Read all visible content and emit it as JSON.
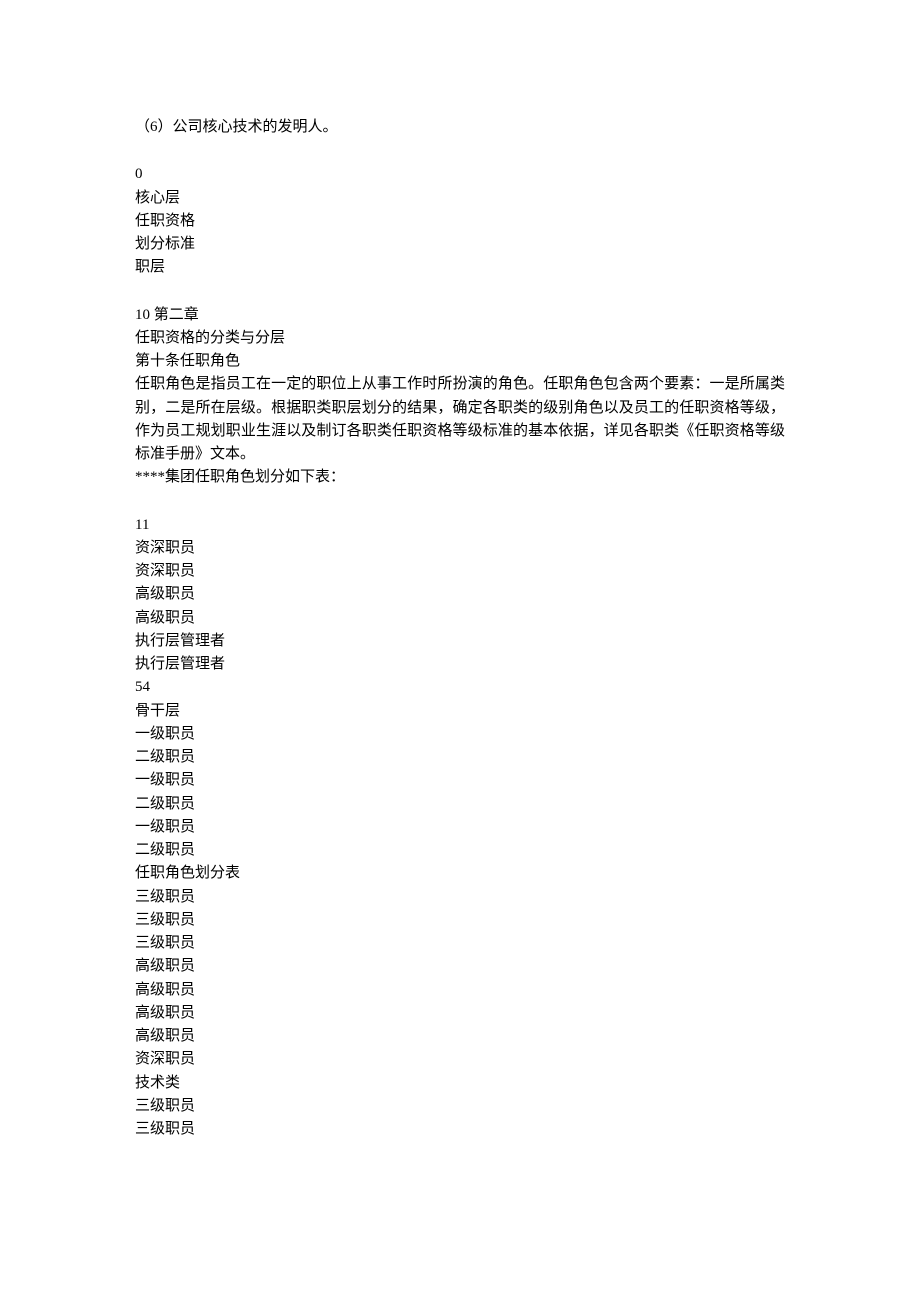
{
  "header_line": "（6）公司核心技术的发明人。",
  "section_a": {
    "lines": [
      "0",
      "核心层",
      "任职资格",
      "划分标准",
      "职层"
    ]
  },
  "section_b": {
    "heading": "10  第二章",
    "subtitle": "任职资格的分类与分层",
    "article_title": "第十条任职角色",
    "paragraph": "任职角色是指员工在一定的职位上从事工作时所扮演的角色。任职角色包含两个要素：一是所属类别，二是所在层级。根据职类职层划分的结果，确定各职类的级别角色以及员工的任职资格等级，作为员工规划职业生涯以及制订各职类任职资格等级标准的基本依据，详见各职类《任职资格等级标准手册》文本。",
    "closing": "****集团任职角色划分如下表："
  },
  "section_c": {
    "lines": [
      "11",
      "资深职员",
      "资深职员",
      "高级职员",
      "高级职员",
      "执行层管理者",
      "执行层管理者",
      "54",
      "骨干层",
      "一级职员",
      "二级职员",
      "一级职员",
      "二级职员",
      "一级职员",
      "二级职员",
      "任职角色划分表",
      "三级职员",
      "三级职员",
      "三级职员",
      "高级职员",
      "高级职员",
      "高级职员",
      "高级职员",
      "资深职员",
      "技术类",
      "三级职员",
      "三级职员"
    ]
  }
}
